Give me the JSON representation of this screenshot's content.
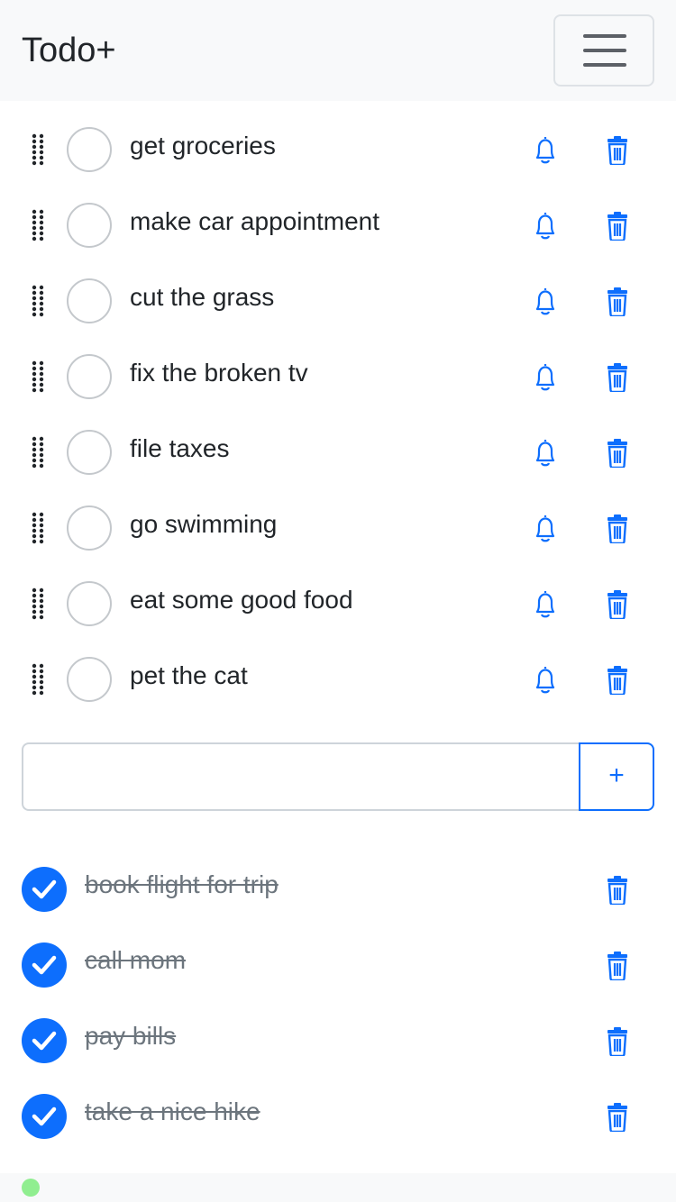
{
  "app": {
    "title": "Todo+"
  },
  "navbar": {
    "menu_icon": "hamburger-icon"
  },
  "colors": {
    "accent": "#0d6efd",
    "done_text": "#6c757d",
    "status": "#90ee90"
  },
  "todos": [
    {
      "text": "get groceries"
    },
    {
      "text": "make car appointment"
    },
    {
      "text": "cut the grass"
    },
    {
      "text": "fix the broken tv"
    },
    {
      "text": "file taxes"
    },
    {
      "text": "go swimming"
    },
    {
      "text": "eat some good food"
    },
    {
      "text": "pet the cat"
    }
  ],
  "add_todo": {
    "value": "",
    "placeholder": "",
    "button_label": "+"
  },
  "completed": [
    {
      "text": "book flight for trip"
    },
    {
      "text": "call mom"
    },
    {
      "text": "pay bills"
    },
    {
      "text": "take a nice hike"
    }
  ]
}
